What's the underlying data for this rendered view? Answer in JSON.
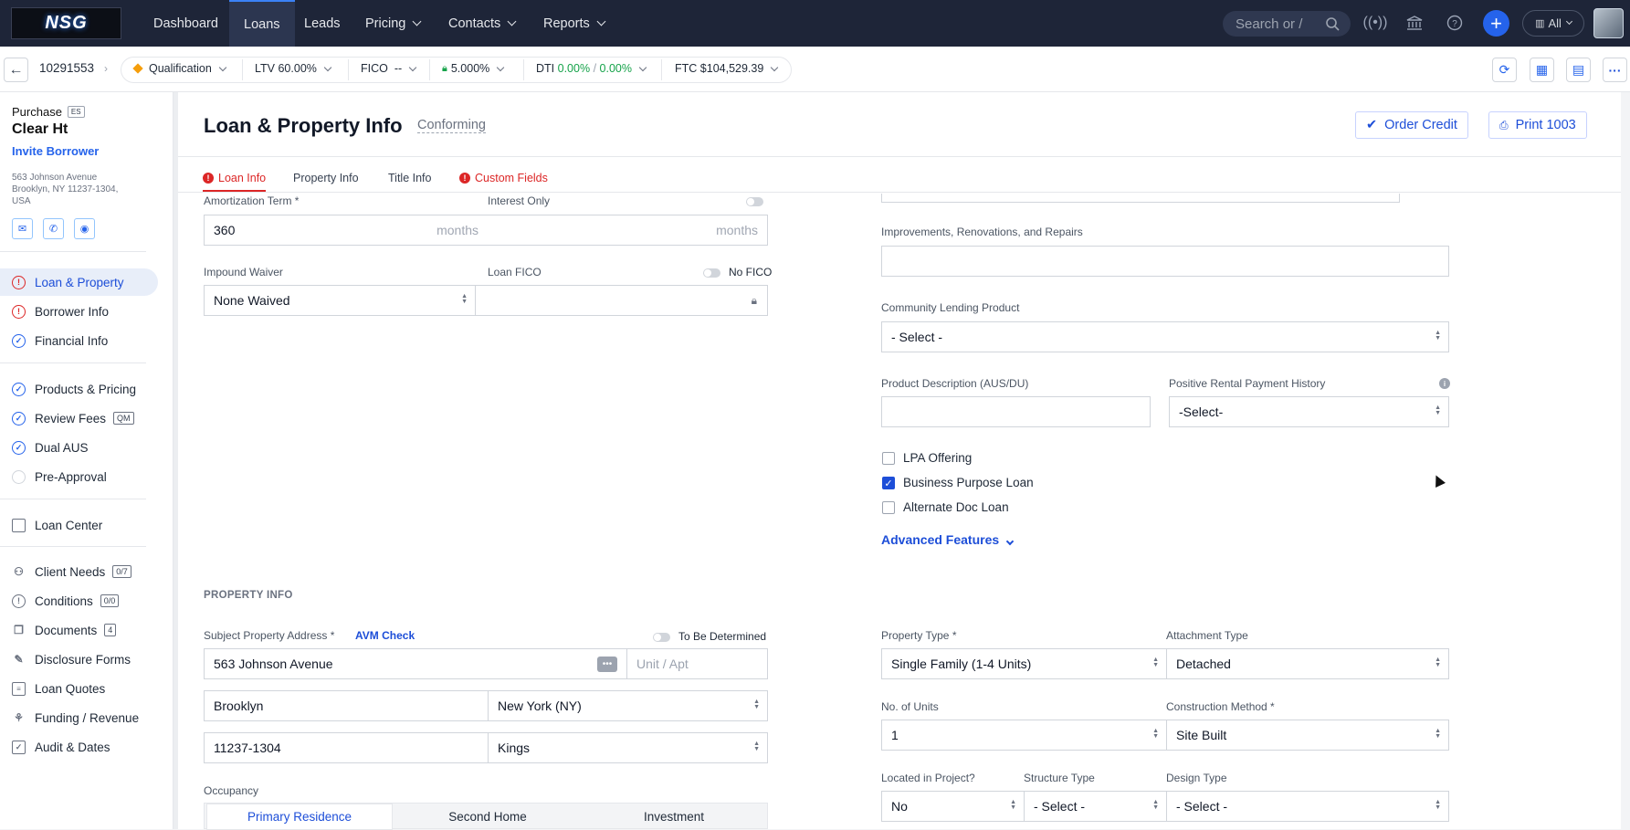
{
  "app": {
    "logo_text": "NSG"
  },
  "topnav": {
    "items": [
      {
        "label": "Dashboard"
      },
      {
        "label": "Loans"
      },
      {
        "label": "Leads"
      },
      {
        "label": "Pricing"
      },
      {
        "label": "Contacts"
      },
      {
        "label": "Reports"
      }
    ],
    "search_placeholder": "Search or /",
    "all_label": "All"
  },
  "subbar": {
    "loan_number": "10291553",
    "status": "Qualification",
    "ltv_label": "LTV",
    "ltv_value": "60.00%",
    "fico_label": "FICO",
    "fico_value": "--",
    "rate_value": "5.000%",
    "dti_label": "DTI",
    "dti_front": "0.00%",
    "dti_sep": "/",
    "dti_back": "0.00%",
    "ftc_label": "FTC",
    "ftc_value": "$104,529.39"
  },
  "sidebar": {
    "loan_purpose": "Purchase",
    "purpose_badge": "ES",
    "borrower_name": "Clear Ht",
    "invite_label": "Invite Borrower",
    "address_line1": "563 Johnson Avenue",
    "address_line2": "Brooklyn, NY 11237-1304,",
    "address_line3": "USA",
    "items": [
      {
        "label": "Loan & Property",
        "status": "error"
      },
      {
        "label": "Borrower Info",
        "status": "error"
      },
      {
        "label": "Financial Info",
        "status": "ok"
      },
      {
        "label": "Products & Pricing",
        "status": "ok"
      },
      {
        "label": "Review Fees",
        "status": "ok",
        "badge": "QM"
      },
      {
        "label": "Dual AUS",
        "status": "ok"
      },
      {
        "label": "Pre-Approval",
        "status": "empty"
      },
      {
        "label": "Loan Center"
      },
      {
        "label": "Client Needs",
        "badge": "0/7"
      },
      {
        "label": "Conditions",
        "badge": "0/0"
      },
      {
        "label": "Documents",
        "badge": "4"
      },
      {
        "label": "Disclosure Forms"
      },
      {
        "label": "Loan Quotes"
      },
      {
        "label": "Funding / Revenue"
      },
      {
        "label": "Audit & Dates"
      }
    ]
  },
  "page": {
    "title": "Loan & Property Info",
    "subtitle": "Conforming",
    "order_credit": "Order Credit",
    "print_1003": "Print 1003",
    "tabs": [
      {
        "label": "Loan Info"
      },
      {
        "label": "Property Info"
      },
      {
        "label": "Title Info"
      },
      {
        "label": "Custom Fields"
      }
    ]
  },
  "loan_info": {
    "amortization_label": "Amortization Term *",
    "amortization_value": "360",
    "amortization_unit": "months",
    "interest_only_label": "Interest Only",
    "interest_only_unit": "months",
    "impound_label": "Impound Waiver",
    "impound_value": "None Waived",
    "loan_fico_label": "Loan FICO",
    "no_fico_label": "No FICO",
    "improvements_label": "Improvements, Renovations, and Repairs",
    "community_label": "Community Lending Product",
    "community_value": "- Select -",
    "product_desc_label": "Product Description (AUS/DU)",
    "rental_label": "Positive Rental Payment History",
    "rental_value": "-Select-",
    "lpa_label": "LPA Offering",
    "business_label": "Business Purpose Loan",
    "business_checked": true,
    "altdoc_label": "Alternate Doc Loan",
    "advanced_label": "Advanced Features"
  },
  "property_info": {
    "section_title": "PROPERTY INFO",
    "address_label": "Subject Property Address *",
    "avm_label": "AVM Check",
    "tbd_label": "To Be Determined",
    "street": "563 Johnson Avenue",
    "unit_placeholder": "Unit / Apt",
    "city": "Brooklyn",
    "state": "New York (NY)",
    "zip": "11237-1304",
    "county": "Kings",
    "occupancy_label": "Occupancy",
    "occupancy_options": [
      "Primary Residence",
      "Second Home",
      "Investment"
    ],
    "occupancy_selected": "Primary Residence",
    "property_type_label": "Property Type *",
    "property_type_value": "Single Family (1-4 Units)",
    "attachment_label": "Attachment Type",
    "attachment_value": "Detached",
    "units_label": "No. of Units",
    "units_value": "1",
    "construction_label": "Construction Method *",
    "construction_value": "Site Built",
    "project_label": "Located in Project?",
    "project_value": "No",
    "structure_label": "Structure Type",
    "structure_value": "- Select -",
    "design_label": "Design Type",
    "design_value": "- Select -"
  }
}
